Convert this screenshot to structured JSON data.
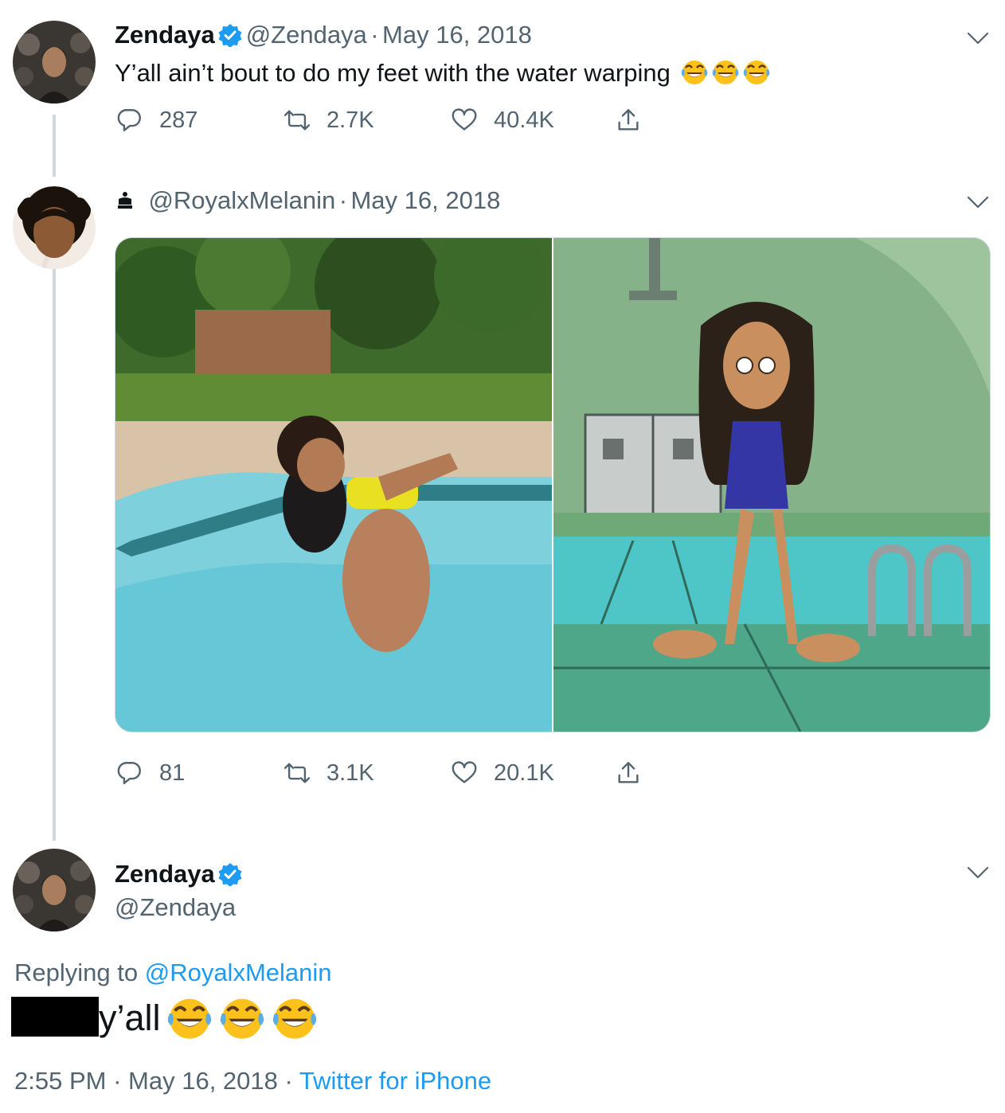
{
  "colors": {
    "accent": "#1d9bf0",
    "text": "#0f1419",
    "muted": "#536471",
    "verified": "#1d9bf0"
  },
  "tweet1": {
    "name": "Zendaya",
    "handle": "@Zendaya",
    "sep": "·",
    "date": "May 16, 2018",
    "text": "Y’all ain’t bout to do my feet with the water warping",
    "emoji": "face-with-tears-of-joy x3",
    "replies": "287",
    "retweets": "2.7K",
    "likes": "40.4K"
  },
  "tweet2": {
    "handle": "@RoyalxMelanin",
    "sep": "·",
    "date": "May 16, 2018",
    "replies": "81",
    "retweets": "3.1K",
    "likes": "20.1K",
    "media": [
      "photo-pool-girl-dog",
      "cartoon-girl-pool-feet"
    ]
  },
  "tweet3": {
    "name": "Zendaya",
    "handle": "@Zendaya",
    "replying_prefix": "Replying to",
    "replying_handle": "@RoyalxMelanin",
    "text": "y’all",
    "time": "2:55 PM",
    "sep": "·",
    "date": "May 16, 2018",
    "source": "Twitter for iPhone"
  }
}
